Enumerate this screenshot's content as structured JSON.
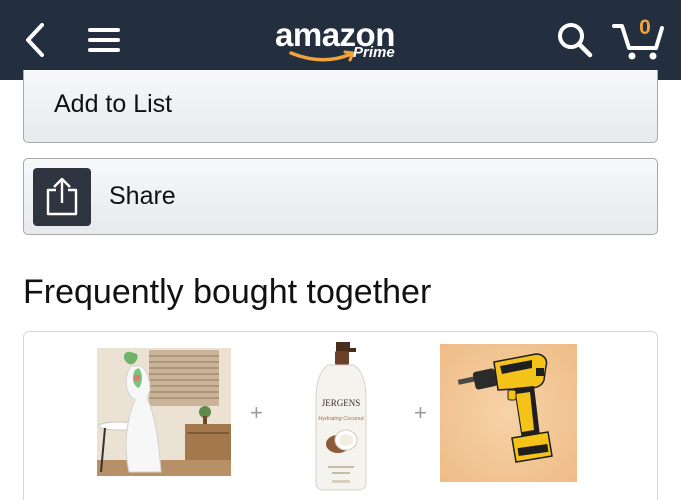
{
  "header": {
    "brand": "amazon",
    "tier": "Prime",
    "cart_count": "0",
    "icons": {
      "back": "chevron-left-icon",
      "menu": "hamburger-menu-icon",
      "search": "search-icon",
      "cart": "cart-icon"
    },
    "colors": {
      "bar": "#232f3e",
      "accent": "#f0a33a"
    }
  },
  "actions": {
    "add_to_list": "Add to List",
    "share": "Share",
    "share_icon": "share-icon"
  },
  "frequently_bought": {
    "title": "Frequently bought together",
    "separator": "+",
    "products": [
      {
        "image": "room-figure-image"
      },
      {
        "image": "jergens-lotion-image",
        "brand_text": "JERGENS",
        "product_text": "Hydrating Coconut"
      },
      {
        "image": "power-drill-image"
      }
    ]
  }
}
